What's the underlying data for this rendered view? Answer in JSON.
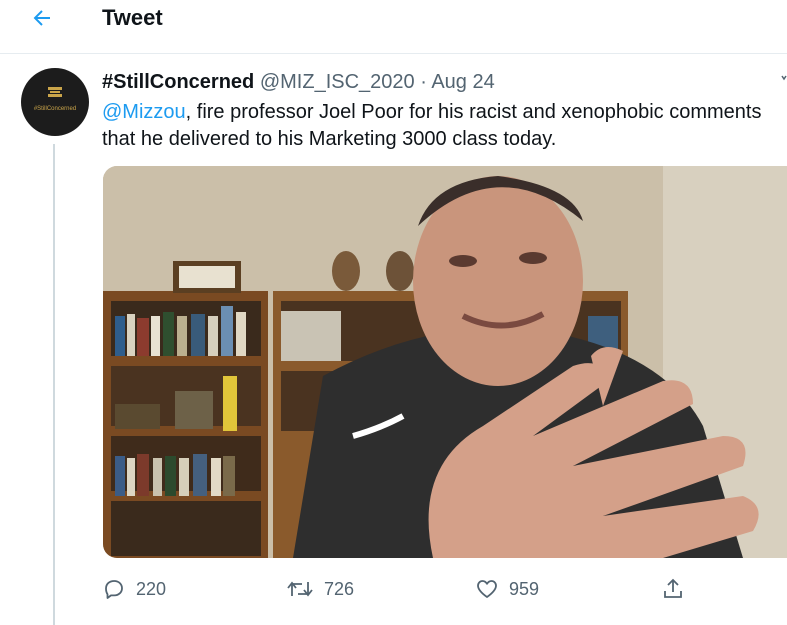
{
  "header": {
    "title": "Tweet",
    "back_icon": "arrow-left-icon",
    "accent": "#1d9bf0"
  },
  "avatar": {
    "label": "#StillConcerned"
  },
  "tweet": {
    "display_name": "#StillConcerned",
    "handle": "@MIZ_ISC_2020",
    "separator": "·",
    "date": "Aug 24",
    "mention": "@Mizzou",
    "text": ", fire professor Joel Poor for his racist and xenophobic comments that he delivered to his Marketing 3000 class today."
  },
  "actions": {
    "replies": "220",
    "retweets": "726",
    "likes": "959"
  },
  "colors": {
    "text": "#0f1419",
    "secondary": "#536471",
    "link": "#1d9bf0",
    "divider": "#e6ecf0"
  }
}
